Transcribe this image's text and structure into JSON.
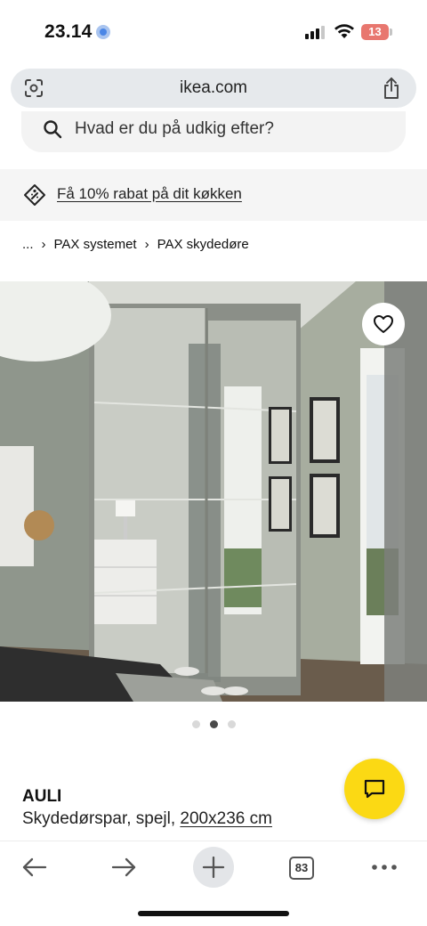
{
  "status_bar": {
    "time": "23.14",
    "battery": "13"
  },
  "browser": {
    "url": "ikea.com",
    "tabs_count": "83"
  },
  "search": {
    "placeholder": "Hvad er du på udkig efter?"
  },
  "promo": {
    "text": "Få 10% rabat på dit køkken"
  },
  "breadcrumb": [
    "...",
    "PAX systemet",
    "PAX skydedøre"
  ],
  "carousel": {
    "total": 3,
    "active_index": 1
  },
  "product": {
    "name": "AULI",
    "description": "Skydedørspar, spejl, ",
    "size": "200x236 cm"
  },
  "colors": {
    "ikea_yellow": "#fbd914",
    "address_bar": "#e6e9ec",
    "battery_low": "#e8776f"
  },
  "icons": {
    "address_left": "page-settings-icon",
    "address_right": "share-icon",
    "search": "search-icon",
    "promo": "price-tag-icon",
    "favourite": "heart-icon",
    "chat": "chat-icon",
    "toolbar": [
      "back-arrow-icon",
      "forward-arrow-icon",
      "plus-icon",
      "tabs-icon",
      "more-icon"
    ]
  }
}
